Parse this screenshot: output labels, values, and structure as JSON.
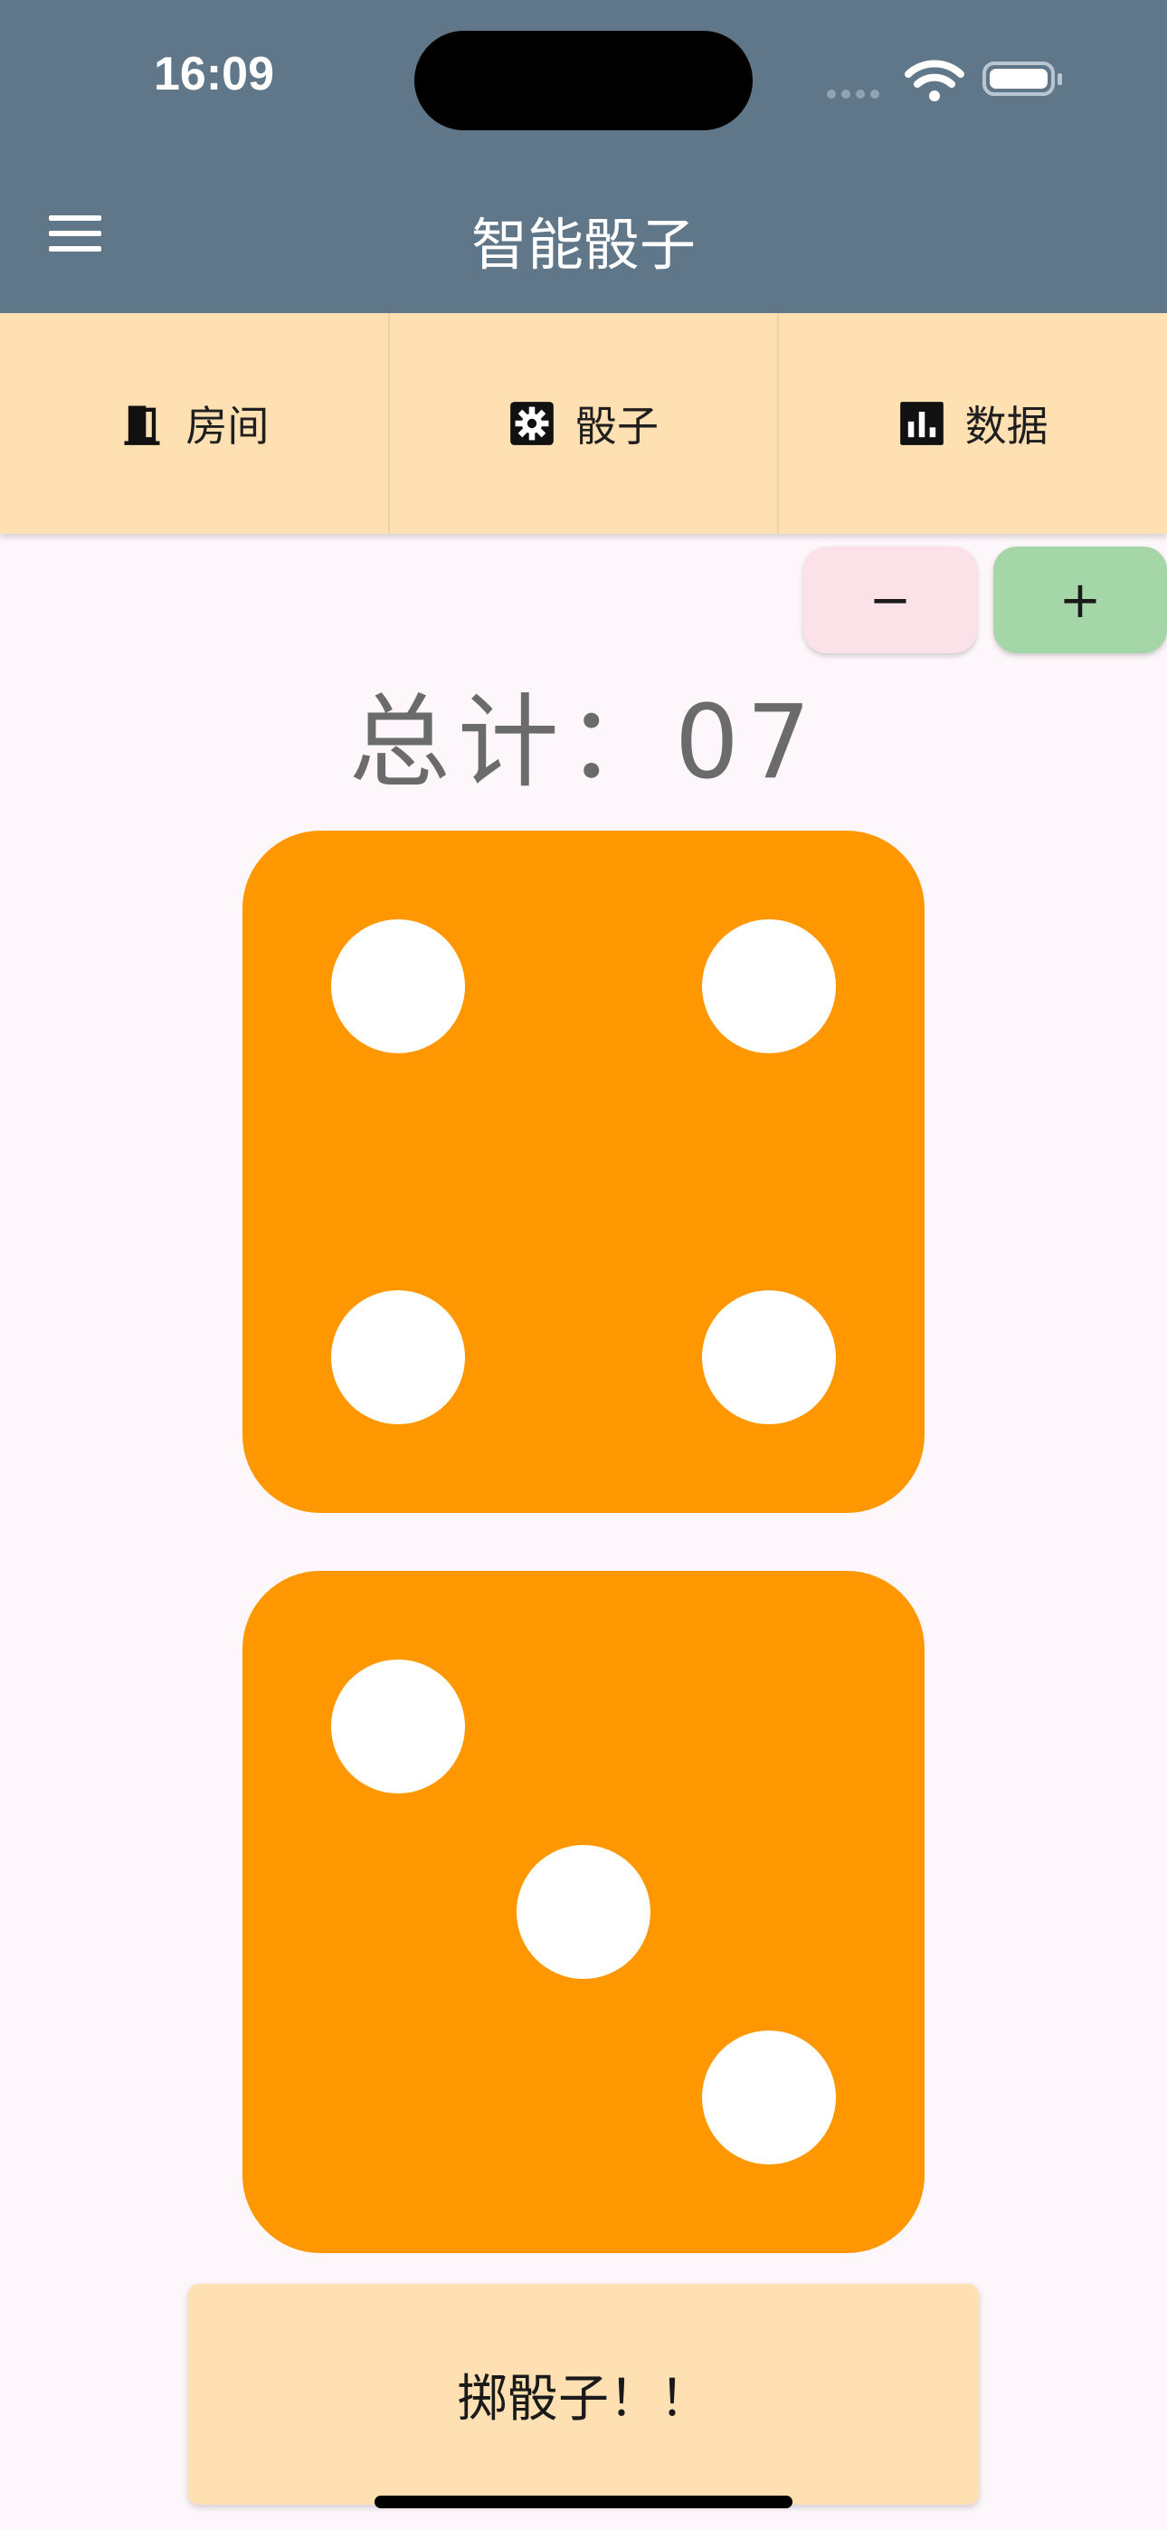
{
  "status_bar": {
    "time": "16:09"
  },
  "app_bar": {
    "title": "智能骰子",
    "menu_icon": "hamburger-menu-icon"
  },
  "tabs": [
    {
      "label": "房间",
      "icon": "door-icon"
    },
    {
      "label": "骰子",
      "icon": "gear-icon"
    },
    {
      "label": "数据",
      "icon": "bar-chart-icon"
    }
  ],
  "controls": {
    "minus_label": "−",
    "plus_label": "+"
  },
  "total": {
    "label": "总计：",
    "value": "07"
  },
  "dice": [
    {
      "value": 4
    },
    {
      "value": 3
    }
  ],
  "roll_button": {
    "label": "掷骰子！！"
  },
  "colors": {
    "app_bar": "#607789",
    "tab_bar": "#ffe0b2",
    "die": "#ff9800",
    "pip": "#ffffff",
    "minus_button": "#fbe2e8",
    "plus_button": "#a5d6a7",
    "background": "#fdf7fb"
  }
}
